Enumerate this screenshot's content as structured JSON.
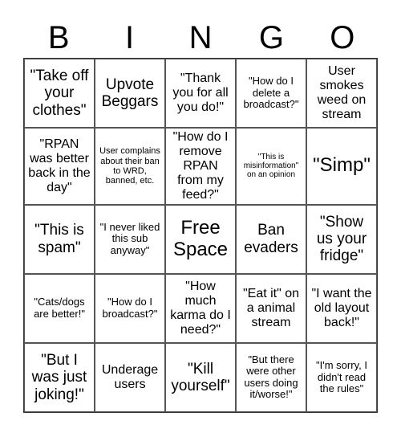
{
  "header": {
    "letters": [
      "B",
      "I",
      "N",
      "G",
      "O"
    ]
  },
  "cells": [
    {
      "text": "\"Take off your clothes\"",
      "size": "l"
    },
    {
      "text": "Upvote Beggars",
      "size": "l"
    },
    {
      "text": "\"Thank you for all you do!\"",
      "size": "m"
    },
    {
      "text": "\"How do I delete a broadcast?\"",
      "size": "s"
    },
    {
      "text": "User smokes weed on stream",
      "size": "m"
    },
    {
      "text": "\"RPAN was better back in the day\"",
      "size": "m"
    },
    {
      "text": "User complains about their ban to WRD, banned, etc.",
      "size": "xs"
    },
    {
      "text": "\"How do I remove RPAN from my feed?\"",
      "size": "m"
    },
    {
      "text": "\"This is misinformation\" on an opinion",
      "size": "xxs"
    },
    {
      "text": "\"Simp\"",
      "size": "xl"
    },
    {
      "text": "\"This is spam\"",
      "size": "l"
    },
    {
      "text": "\"I never liked this sub anyway\"",
      "size": "s"
    },
    {
      "text": "Free Space",
      "size": "xl"
    },
    {
      "text": "Ban evaders",
      "size": "l"
    },
    {
      "text": "\"Show us your fridge\"",
      "size": "l"
    },
    {
      "text": "\"Cats/dogs are better!\"",
      "size": "s"
    },
    {
      "text": "\"How do I broadcast?\"",
      "size": "s"
    },
    {
      "text": "\"How much karma do I need?\"",
      "size": "m"
    },
    {
      "text": "\"Eat it\" on a animal stream",
      "size": "m"
    },
    {
      "text": "\"I want the old layout back!\"",
      "size": "m"
    },
    {
      "text": "\"But I was just joking!\"",
      "size": "l"
    },
    {
      "text": "Underage users",
      "size": "m"
    },
    {
      "text": "\"Kill yourself\"",
      "size": "l"
    },
    {
      "text": "\"But there were other users doing it/worse!\"",
      "size": "s"
    },
    {
      "text": "\"I'm sorry, I didn't read the rules\"",
      "size": "s"
    }
  ]
}
